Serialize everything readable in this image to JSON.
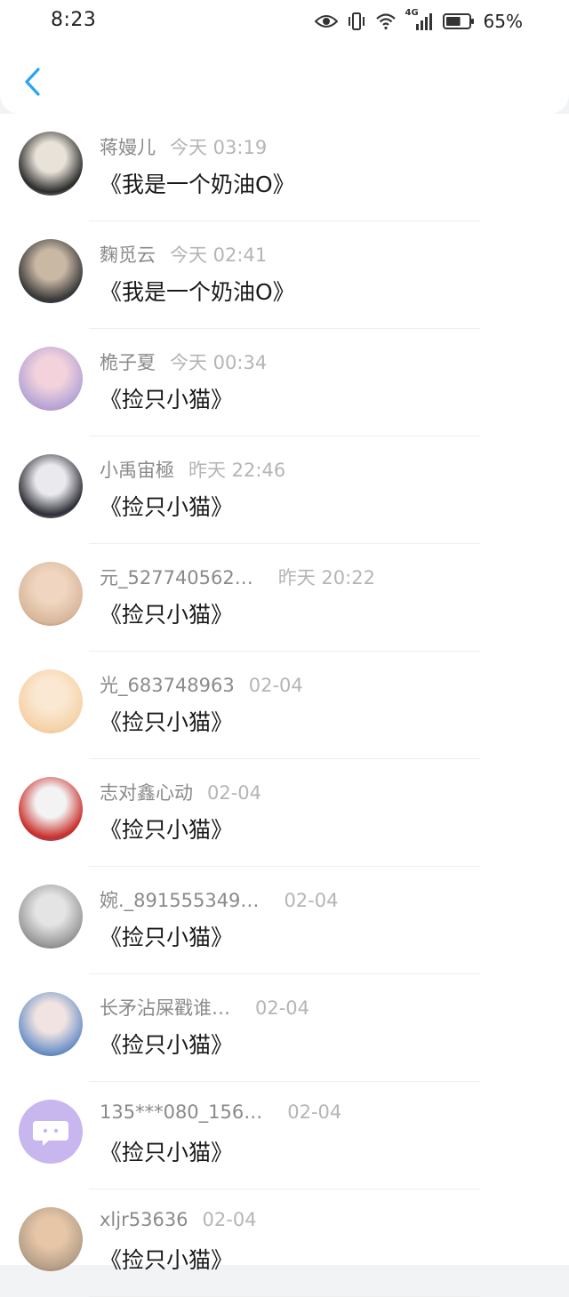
{
  "status_bar": {
    "time": "8:23",
    "network_label": "4G",
    "battery_percent": "65%",
    "battery_level": 0.65,
    "icons": [
      "eye-icon",
      "vibrate-icon",
      "wifi-icon",
      "signal-icon",
      "battery-icon"
    ]
  },
  "nav": {
    "back_icon": "chevron-left-icon",
    "accent_color": "#2aa3f5"
  },
  "messages": [
    {
      "name": "蒋嫚儿",
      "time": "今天 03:19",
      "title": "《我是一个奶油O》",
      "avatar": "flower-photo"
    },
    {
      "name": "麴觅云",
      "time": "今天 02:41",
      "title": "《我是一个奶油O》",
      "avatar": "portrait-photo"
    },
    {
      "name": "桅子夏",
      "time": "今天 00:34",
      "title": "《捡只小猫》",
      "avatar": "portrait-photo"
    },
    {
      "name": "小禹宙極",
      "time": "昨天 22:46",
      "title": "《捡只小猫》",
      "avatar": "portrait-photo"
    },
    {
      "name": "元_527740562…",
      "time": "昨天 20:22",
      "title": "《捡只小猫》",
      "avatar": "portrait-photo"
    },
    {
      "name": "光_683748963",
      "time": "02-04",
      "title": "《捡只小猫》",
      "avatar": "anime-illustration"
    },
    {
      "name": "志对鑫心动",
      "time": "02-04",
      "title": "《捡只小猫》",
      "avatar": "portrait-photo"
    },
    {
      "name": "婉._891555349…",
      "time": "02-04",
      "title": "《捡只小猫》",
      "avatar": "sketch-illustration"
    },
    {
      "name": "长矛沾屎戳谁…",
      "time": "02-04",
      "title": "《捡只小猫》",
      "avatar": "portrait-photo"
    },
    {
      "name": "135***080_156…",
      "time": "02-04",
      "title": "《捡只小猫》",
      "avatar": "chat-bubble-icon"
    },
    {
      "name": "xljr53636",
      "time": "02-04",
      "title": "《捡只小猫》",
      "avatar": "palace-photo"
    }
  ]
}
